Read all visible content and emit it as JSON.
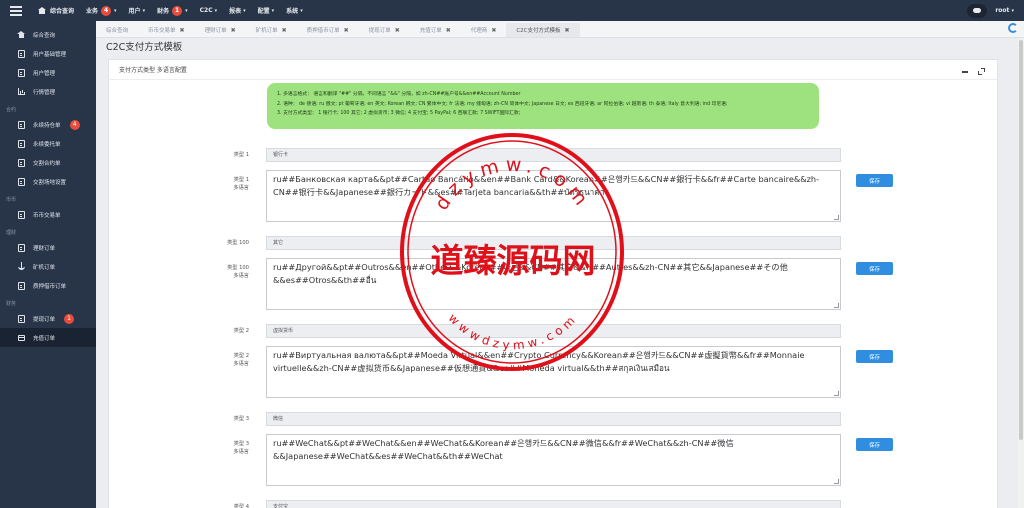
{
  "topbar": {
    "nav": [
      {
        "label": "综合查询",
        "badge": null,
        "caret": false
      },
      {
        "label": "业务",
        "badge": "4",
        "caret": true
      },
      {
        "label": "用户",
        "badge": null,
        "caret": true
      },
      {
        "label": "财务",
        "badge": "1",
        "caret": true
      },
      {
        "label": "C2C",
        "badge": null,
        "caret": true
      },
      {
        "label": "报表",
        "badge": null,
        "caret": true
      },
      {
        "label": "配置",
        "badge": null,
        "caret": true
      },
      {
        "label": "系统",
        "badge": null,
        "caret": true
      }
    ],
    "user": "root"
  },
  "sidebar": {
    "groups": [
      {
        "section": "",
        "items": [
          {
            "label": "综合查询",
            "icon": "home",
            "badge": null,
            "active": false
          },
          {
            "label": "用户基础管理",
            "icon": "doc",
            "badge": null,
            "active": false
          },
          {
            "label": "用户管理",
            "icon": "doc",
            "badge": null,
            "active": false
          },
          {
            "label": "行情管理",
            "icon": "bars",
            "badge": null,
            "active": false
          }
        ]
      },
      {
        "section": "合约",
        "items": [
          {
            "label": "永续持仓单",
            "icon": "doc",
            "badge": "4",
            "active": false
          },
          {
            "label": "永续委托单",
            "icon": "doc",
            "badge": null,
            "active": false
          },
          {
            "label": "交割合约单",
            "icon": "doc",
            "badge": null,
            "active": false
          },
          {
            "label": "交割场地设置",
            "icon": "doc",
            "badge": null,
            "active": false
          }
        ]
      },
      {
        "section": "币币",
        "items": [
          {
            "label": "币币交易单",
            "icon": "doc",
            "badge": null,
            "active": false
          }
        ]
      },
      {
        "section": "理财",
        "items": [
          {
            "label": "理财订单",
            "icon": "doc",
            "badge": null,
            "active": false
          },
          {
            "label": "矿机订单",
            "icon": "anchor",
            "badge": null,
            "active": false
          },
          {
            "label": "质押借币订单",
            "icon": "doc",
            "badge": null,
            "active": false
          }
        ]
      },
      {
        "section": "财务",
        "items": [
          {
            "label": "提现订单",
            "icon": "doc",
            "badge": "1",
            "active": false
          },
          {
            "label": "充值订单",
            "icon": "card",
            "badge": null,
            "active": true
          }
        ]
      }
    ]
  },
  "tabs": [
    {
      "label": "综合查询",
      "closable": false,
      "active": false
    },
    {
      "label": "币币交易单",
      "closable": true,
      "active": false
    },
    {
      "label": "理财订单",
      "closable": true,
      "active": false
    },
    {
      "label": "矿机订单",
      "closable": true,
      "active": false
    },
    {
      "label": "质押借币订单",
      "closable": true,
      "active": false
    },
    {
      "label": "提现订单",
      "closable": true,
      "active": false
    },
    {
      "label": "充值订单",
      "closable": true,
      "active": false
    },
    {
      "label": "代理商",
      "closable": true,
      "active": false
    },
    {
      "label": "C2C支付方式模板",
      "closable": true,
      "active": true
    }
  ],
  "page": {
    "title": "C2C支付方式模板",
    "panel_title": "支付方式类型 多语言配置",
    "notice": [
      "1. 多语言格式：  语言和翻译 \"##\" 分隔，不同语言 \"&&\" 分隔，如 zh-CN##账户号&&en##Account Number",
      "2. 语种：  de 德语; ru 俄文; pt 葡萄牙语; en 英文; Korean 韩文; CN 繁体中文; fr 法语; my 缅甸语; zh-CN 简体中文; Japanese 日文; es 西班牙语; ar 阿拉伯语; vi 越南语; th 泰语; Italy 意大利语; ind 印尼语;",
      "3. 支付方式类型：  1 银行卡; 100 其它; 2 虚拟货币; 3 微信; 4 支付宝; 5 PayPal; 6 西联汇款; 7 SWIFT国际汇款;"
    ],
    "multi_lang_label": "多语言",
    "save_label": "保存",
    "rows": [
      {
        "type_label": "类型 1",
        "name": "银行卡",
        "text": "ru##Банковская карта&&pt##Cartão Bancário&&en##Bank Card&&Korean##은행카드&&CN##銀行卡&&fr##Carte bancaire&&zh-CN##银行卡&&Japanese##銀行カード&&es##Tarjeta bancaria&&th##บัตรธนาคาร"
      },
      {
        "type_label": "类型 100",
        "name": "其它",
        "text": "ru##Другой&&pt##Outros&&en##Other&&Korean##다른&&CN##其它&&fr##Autres&&zh-CN##其它&&Japanese##その他&&es##Otros&&th##อื่น"
      },
      {
        "type_label": "类型 2",
        "name": "虚拟货币",
        "text": "ru##Виртуальная валюта&&pt##Moeda Virtual&&en##Crypto Currency&&Korean##은행카드&&CN##虛擬貨幣&&fr##Monnaie virtuelle&&zh-CN##虚拟货币&&Japanese##仮想通貨&&es##Moneda virtual&&th##สกุลเงินเสมือน"
      },
      {
        "type_label": "类型 3",
        "name": "微信",
        "text": "ru##WeChat&&pt##WeChat&&en##WeChat&&Korean##은행카드&&CN##微信&&fr##WeChat&&zh-CN##微信&&Japanese##WeChat&&es##WeChat&&th##WeChat"
      },
      {
        "type_label": "类型 4",
        "name": "支付宝",
        "text": ""
      }
    ]
  },
  "watermark": {
    "text": "道臻源码网",
    "arc_top": "dzymw.com",
    "arc_bottom": "wwwdzymw.com",
    "color": "#e0101a"
  }
}
